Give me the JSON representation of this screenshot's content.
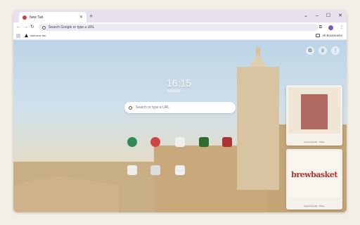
{
  "tab": {
    "title": "New Tab"
  },
  "omnibox": {
    "placeholder": "Search Google or type a URL"
  },
  "bookmarks": {
    "item_label": "welcome tab",
    "all_label": "All Bookmarks"
  },
  "clock": {
    "time": "16:15",
    "date": "FRIDAY"
  },
  "search": {
    "placeholder": "Search or type a URL"
  },
  "cards": [
    {
      "label": "Sponsored Ad · Photo"
    },
    {
      "label": "Sponsored Ad · Photo"
    }
  ],
  "brand": {
    "logo_text": "brewbasket"
  },
  "shortcuts": [
    {
      "color": "#2e8b57"
    },
    {
      "color": "#c44"
    },
    {
      "color": "#e9e9e9"
    },
    {
      "color": "#2f6b2f"
    },
    {
      "color": "#a33"
    },
    {
      "color": "#eee"
    },
    {
      "color": "#ddd"
    },
    {
      "color": "#eee"
    }
  ],
  "colors": {
    "tabstrip": "#e8e0ef",
    "omnibox": "#eeeaf2",
    "accent": "#a8362f"
  }
}
